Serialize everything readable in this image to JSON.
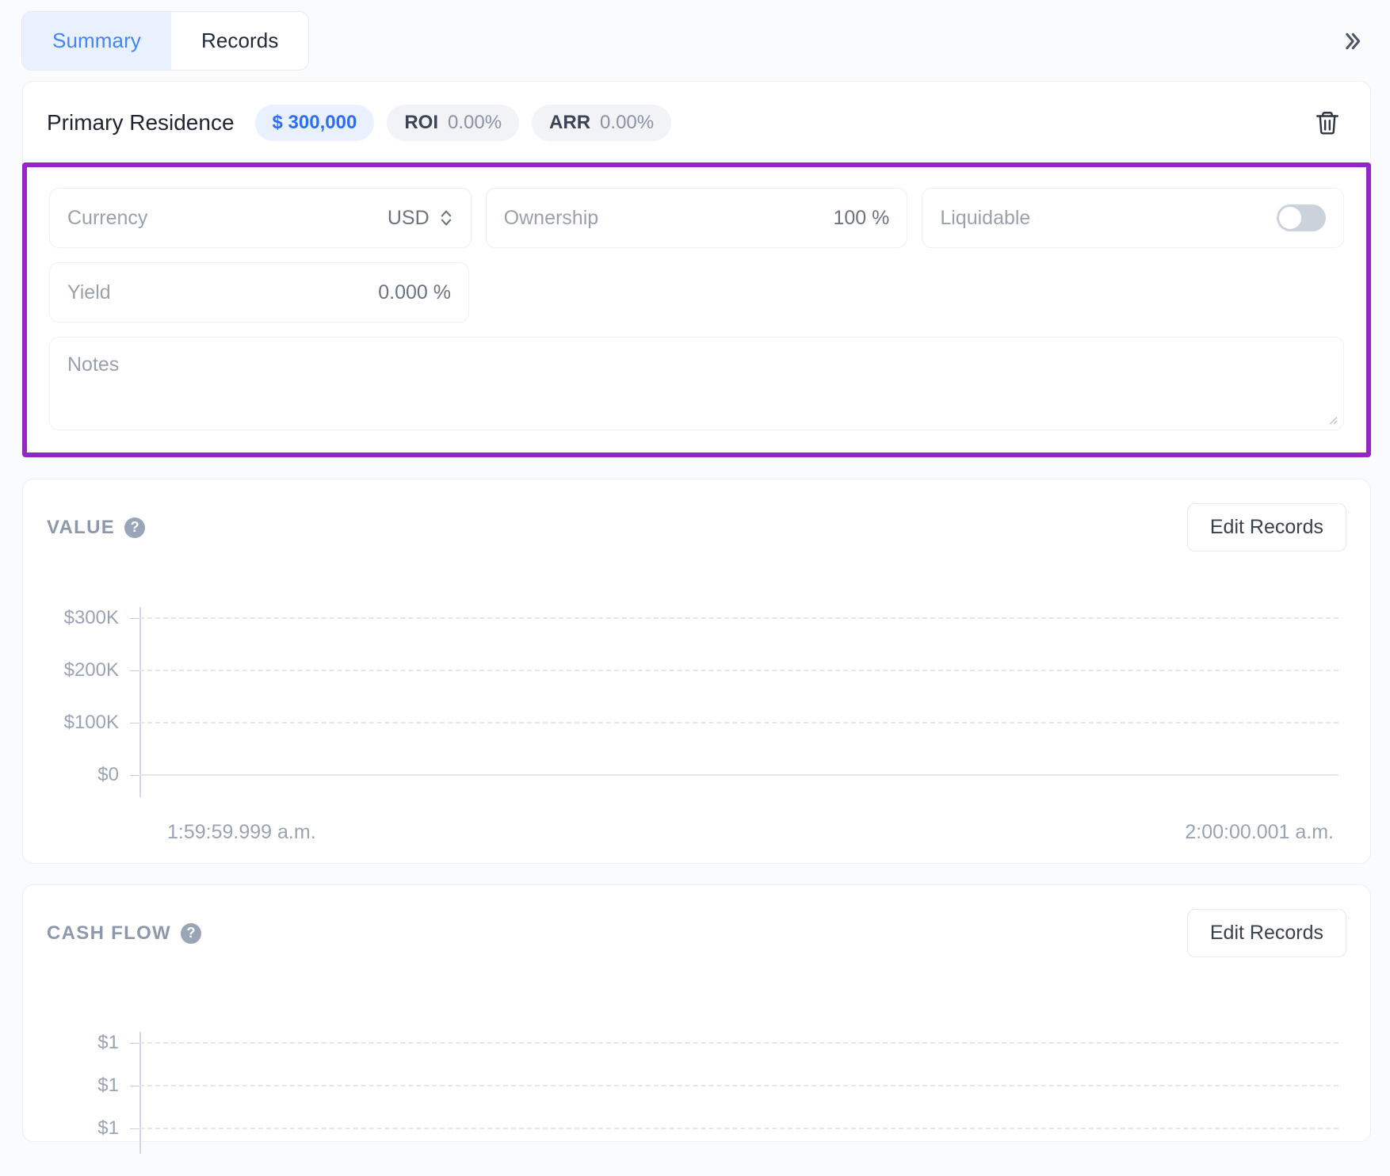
{
  "tabs": [
    {
      "label": "Summary",
      "active": true
    },
    {
      "label": "Records",
      "active": false
    }
  ],
  "collapse_icon": "chevron-double-right-icon",
  "asset": {
    "name": "Primary Residence",
    "value_pill": "$ 300,000",
    "roi_key": "ROI",
    "roi_value": "0.00%",
    "arr_key": "ARR",
    "arr_value": "0.00%",
    "delete_icon": "trash-icon"
  },
  "form": {
    "highlight_color": "#9326c4",
    "currency": {
      "label": "Currency",
      "value": "USD",
      "icon": "chevron-up-down-icon"
    },
    "ownership": {
      "label": "Ownership",
      "value": "100 %"
    },
    "liquidable": {
      "label": "Liquidable",
      "toggle_on": false
    },
    "yield": {
      "label": "Yield",
      "value": "0.000 %"
    },
    "notes": {
      "label": "Notes",
      "value": ""
    }
  },
  "value_section": {
    "title": "VALUE",
    "help_icon": "question-mark-icon",
    "edit_button": "Edit Records"
  },
  "cashflow_section": {
    "title": "CASH FLOW",
    "help_icon": "question-mark-icon",
    "edit_button": "Edit Records"
  },
  "chart_data": [
    {
      "type": "line",
      "title": "VALUE",
      "xlabel": "",
      "ylabel": "",
      "ylim": [
        0,
        300000
      ],
      "yticks": [
        "$0",
        "$100K",
        "$200K",
        "$300K"
      ],
      "ytick_values": [
        0,
        100000,
        200000,
        300000
      ],
      "x": [
        "1:59:59.999 a.m.",
        "2:00:00.001 a.m."
      ],
      "xticks": [
        "1:59:59.999 a.m.",
        "2:00:00.001 a.m."
      ],
      "series": [
        {
          "name": "Value",
          "values": []
        }
      ],
      "grid": true,
      "legend": "none",
      "note": "empty plot - no data points rendered"
    },
    {
      "type": "line",
      "title": "CASH FLOW",
      "xlabel": "",
      "ylabel": "",
      "ylim": [
        1,
        1
      ],
      "yticks": [
        "$1",
        "$1",
        "$1"
      ],
      "ytick_values": [
        1,
        1,
        1
      ],
      "x": [],
      "xticks": [],
      "series": [
        {
          "name": "Cash Flow",
          "values": []
        }
      ],
      "grid": true,
      "legend": "none",
      "note": "empty plot - no data points rendered"
    }
  ]
}
